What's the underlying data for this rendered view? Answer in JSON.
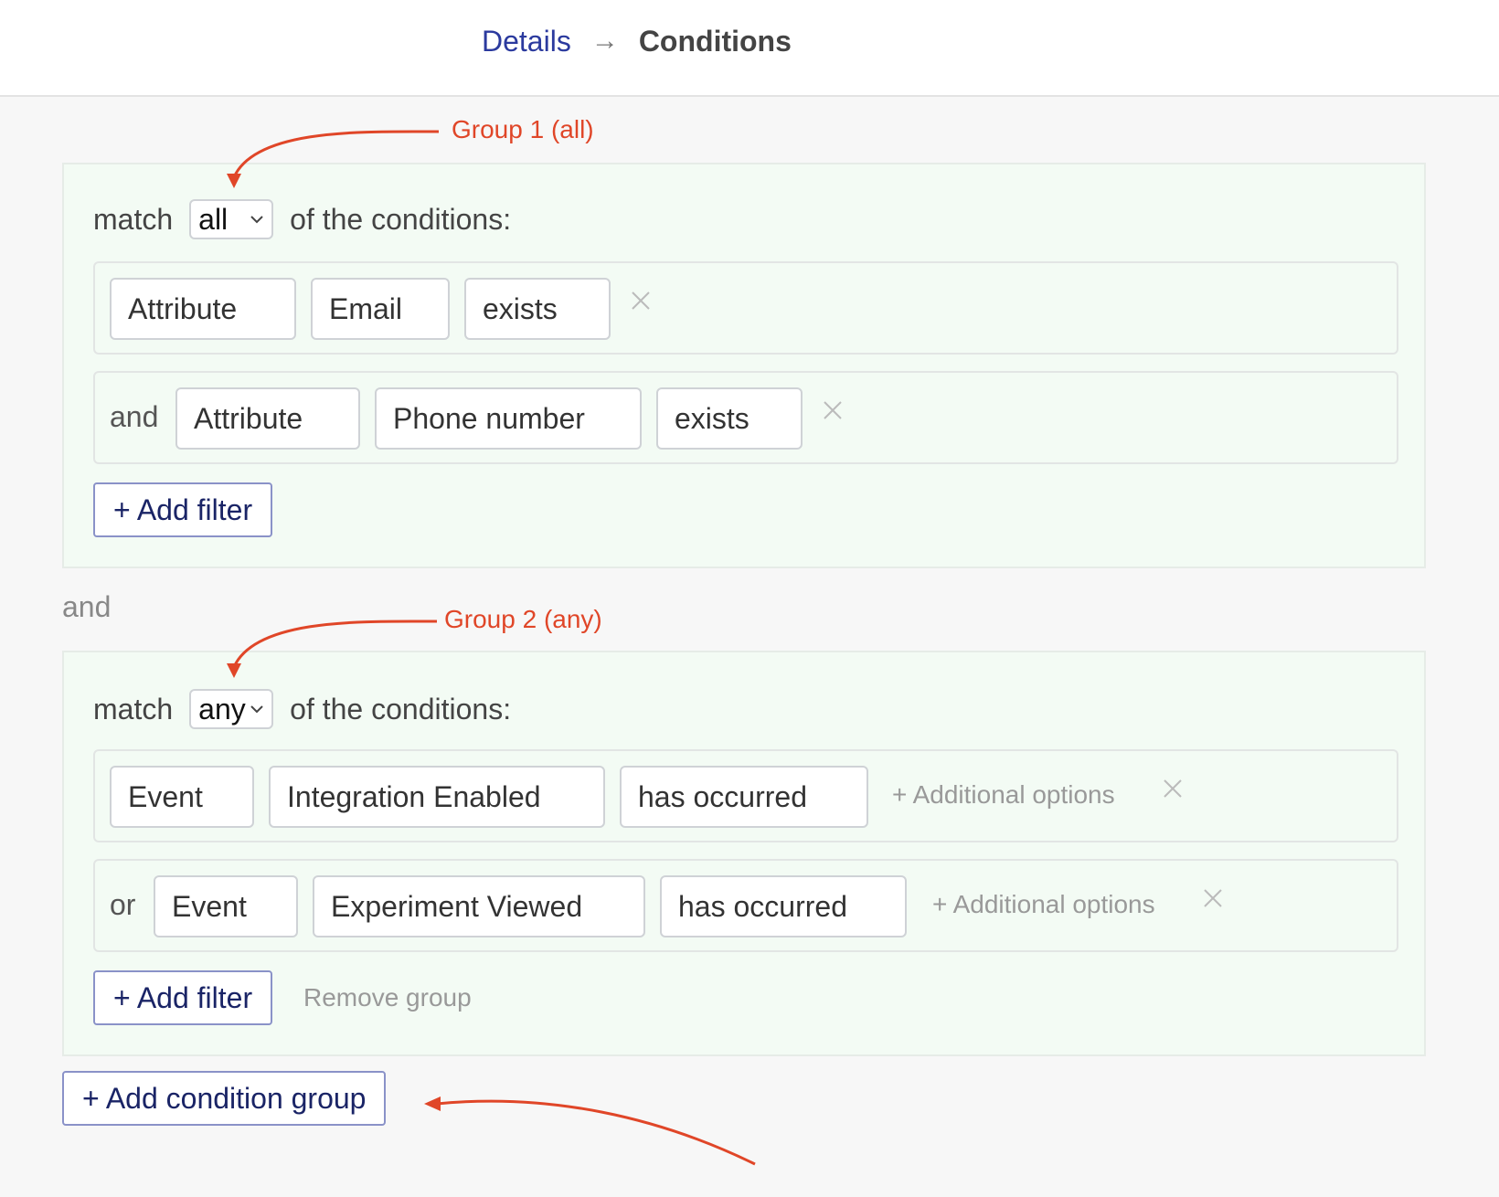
{
  "breadcrumb": {
    "step1": "Details",
    "arrow": "→",
    "step2": "Conditions"
  },
  "annotations": {
    "group1": "Group 1 (all)",
    "group2": "Group 2 (any)"
  },
  "group1": {
    "match_prefix": "match",
    "match_value": "all",
    "match_suffix": "of the conditions:",
    "rows": [
      {
        "joiner": "",
        "type": "Attribute",
        "field": "Email",
        "operator": "exists"
      },
      {
        "joiner": "and",
        "type": "Attribute",
        "field": "Phone number",
        "operator": "exists"
      }
    ],
    "add_filter": "+ Add filter"
  },
  "between_groups": "and",
  "group2": {
    "match_prefix": "match",
    "match_value": "any",
    "match_suffix": "of the conditions:",
    "rows": [
      {
        "joiner": "",
        "type": "Event",
        "field": "Integration Enabled",
        "operator": "has occurred",
        "additional": "+ Additional options"
      },
      {
        "joiner": "or",
        "type": "Event",
        "field": "Experiment Viewed",
        "operator": "has occurred",
        "additional": "+ Additional options"
      }
    ],
    "add_filter": "+ Add filter",
    "remove_group": "Remove group"
  },
  "add_condition_group": "+ Add condition group",
  "icons": {
    "remove": "close-icon",
    "dropdown": "chevron-down-icon"
  },
  "colors": {
    "annotation": "#e04628",
    "link": "#2b3a9e",
    "group_bg": "#f3fbf4",
    "button_text": "#1a2466"
  }
}
